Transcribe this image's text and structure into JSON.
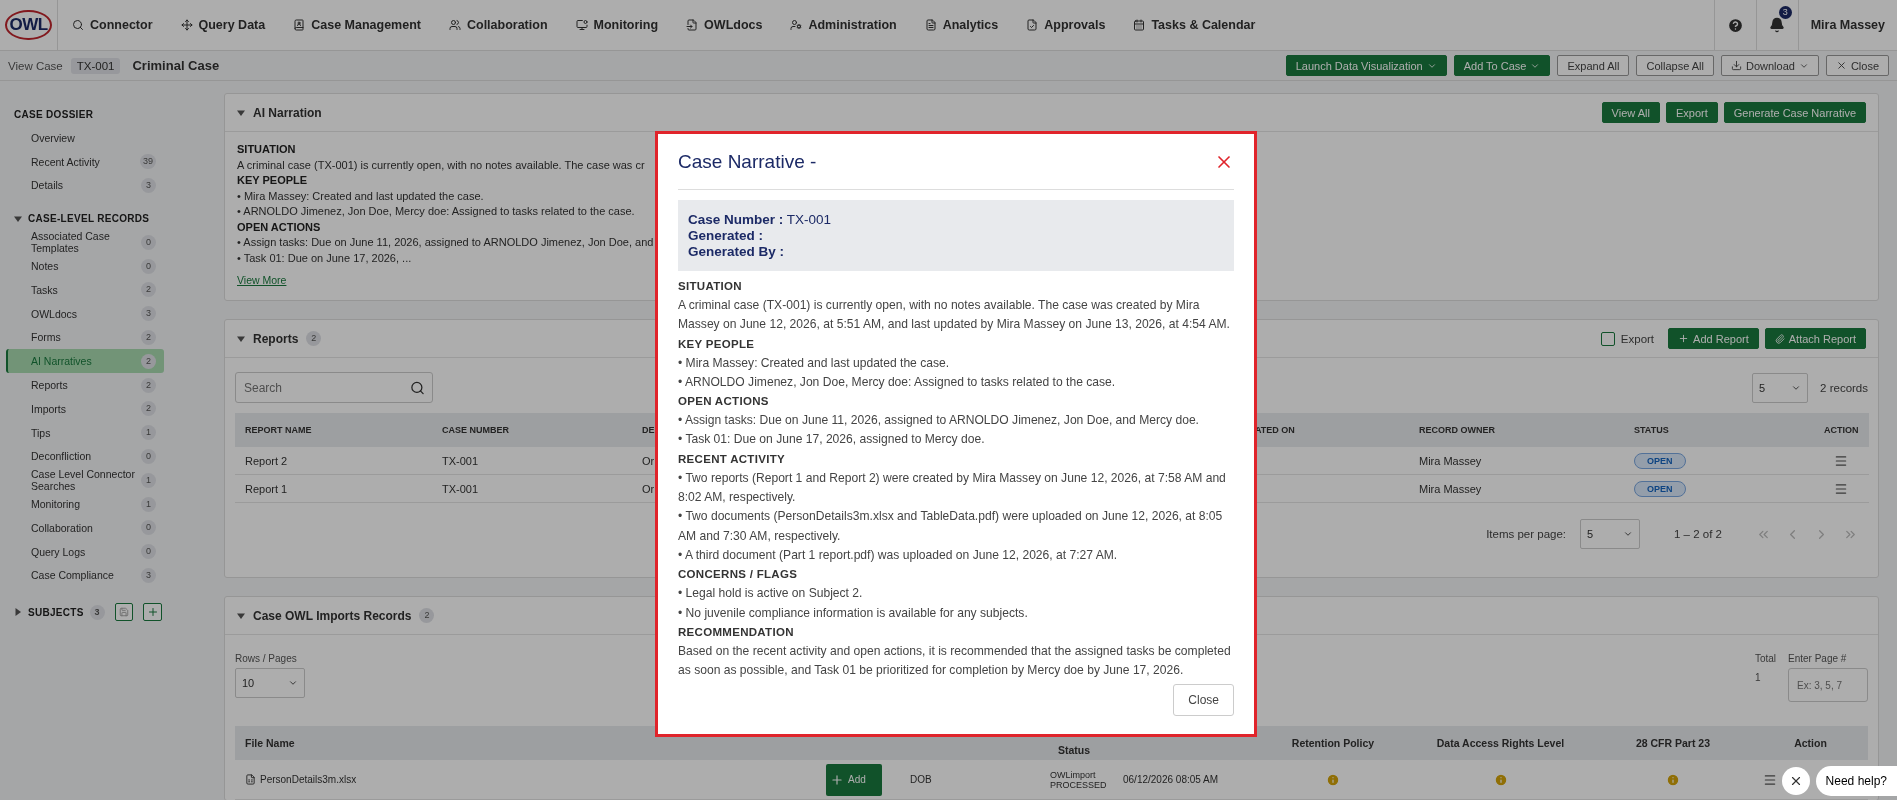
{
  "nav": {
    "logo_text": "OWL",
    "items": [
      "Connector",
      "Query Data",
      "Case Management",
      "Collaboration",
      "Monitoring",
      "OWLdocs",
      "Administration",
      "Analytics",
      "Approvals",
      "Tasks & Calendar"
    ],
    "notification_count": "3",
    "user": "Mira Massey"
  },
  "case_bar": {
    "label": "View Case",
    "case_id": "TX-001",
    "case_type": "Criminal Case",
    "actions": [
      {
        "label": "Launch Data Visualization",
        "kind": "dropdown"
      },
      {
        "label": "Add To Case",
        "kind": "dropdown"
      },
      {
        "label": "Expand All",
        "kind": "outline"
      },
      {
        "label": "Collapse All",
        "kind": "outline"
      },
      {
        "label": "Download",
        "kind": "download"
      },
      {
        "label": "Close",
        "kind": "close"
      }
    ]
  },
  "sidebar": {
    "sections": [
      {
        "title": "CASE DOSSIER",
        "kind": "plain",
        "items": [
          {
            "label": "Overview",
            "selected": false
          },
          {
            "label": "Recent Activity",
            "count": "39",
            "selected": false
          },
          {
            "label": "Details",
            "count": "3",
            "selected": false
          }
        ]
      },
      {
        "title": "CASE-LEVEL RECORDS",
        "kind": "collapsible",
        "expanded": true,
        "items": [
          {
            "label": "Associated Case Templates",
            "count": "0",
            "selected": false
          },
          {
            "label": "Notes",
            "count": "0",
            "selected": false
          },
          {
            "label": "Tasks",
            "count": "2",
            "selected": false
          },
          {
            "label": "OWLdocs",
            "count": "3",
            "selected": false
          },
          {
            "label": "Forms",
            "count": "2",
            "selected": false
          },
          {
            "label": "AI Narratives",
            "count": "2",
            "selected": true
          },
          {
            "label": "Reports",
            "count": "2",
            "selected": false
          },
          {
            "label": "Imports",
            "count": "2",
            "selected": false
          },
          {
            "label": "Tips",
            "count": "1",
            "selected": false
          },
          {
            "label": "Deconfliction",
            "count": "0",
            "selected": false
          },
          {
            "label": "Case Level Connector Searches",
            "count": "1",
            "selected": false
          },
          {
            "label": "Monitoring",
            "count": "1",
            "selected": false
          },
          {
            "label": "Collaboration",
            "count": "0",
            "selected": false
          },
          {
            "label": "Query Logs",
            "count": "0",
            "selected": false
          },
          {
            "label": "Case Compliance",
            "count": "3",
            "selected": false
          }
        ]
      },
      {
        "title": "SUBJECTS",
        "kind": "collapsible",
        "expanded": false,
        "count": "3"
      }
    ]
  },
  "ai_narration": {
    "title": "AI Narration",
    "expanded": true,
    "buttons": [
      "View All",
      "Export",
      "Generate Case Narrative"
    ],
    "lines": [
      {
        "kind": "heading",
        "text": "SITUATION"
      },
      {
        "kind": "text",
        "text": "A criminal case (TX-001) is currently open, with no notes available. The case was cr"
      },
      {
        "kind": "heading",
        "text": "KEY PEOPLE"
      },
      {
        "kind": "text",
        "text": "• Mira Massey: Created and last updated the case."
      },
      {
        "kind": "text",
        "text": "• ARNOLDO Jimenez, Jon Doe, Mercy doe: Assigned to tasks related to the case."
      },
      {
        "kind": "heading",
        "text": "OPEN ACTIONS"
      },
      {
        "kind": "text",
        "text": "• Assign tasks: Due on June 11, 2026, assigned to ARNOLDO Jimenez, Jon Doe, and"
      },
      {
        "kind": "text",
        "text": "• Task 01: Due on June 17, 2026, ..."
      }
    ],
    "link": "View More"
  },
  "reports": {
    "title": "Reports",
    "count": "2",
    "expanded": true,
    "export": {
      "label": "Export",
      "checked": false
    },
    "buttons": [
      "Add Report",
      "Attach Report"
    ],
    "search": {
      "placeholder": "Search"
    },
    "page_size": "5",
    "records": "2 records",
    "columns": [
      "REPORT NAME",
      "CASE NUMBER",
      "DE",
      "ATED ON",
      "RECORD OWNER",
      "STATUS",
      "ACTION"
    ],
    "rows": [
      {
        "cells": [
          "Report 2",
          "TX-001",
          "Or",
          "",
          "Mira Massey"
        ],
        "status": "OPEN"
      },
      {
        "cells": [
          "Report 1",
          "TX-001",
          "Or",
          "",
          "Mira Massey"
        ],
        "status": "OPEN"
      }
    ],
    "pagination": {
      "label": "Items per page:",
      "size": "5",
      "range": "1 – 2 of 2"
    }
  },
  "imports": {
    "title": "Case OWL Imports Records",
    "count": "2",
    "expanded": true,
    "rows_label": "Rows / Pages",
    "rows_value": "10",
    "total_label": "Total",
    "total_value": "1",
    "page_label": "Enter Page #",
    "page_placeholder": "Ex: 3, 5, 7",
    "columns": [
      "File Name",
      "Status",
      "Retention Policy",
      "Data Access Rights Level",
      "28 CFR Part 23",
      "Action"
    ],
    "rows": [
      {
        "file": "PersonDetails3m.xlsx",
        "add_label": "Add",
        "reference": "DOB",
        "status": "OWLimport PROCESSED",
        "uploaded": "06/12/2026 08:05 AM"
      }
    ]
  },
  "modal": {
    "title": "Case Narrative -",
    "info": [
      {
        "label": "Case Number :",
        "value": "TX-001"
      },
      {
        "label": "Generated :"
      },
      {
        "label": "Generated By :"
      }
    ],
    "sections": [
      {
        "heading": "SITUATION",
        "lines": [
          "A criminal case (TX-001) is currently open, with no notes available. The case was created by Mira Massey on June 12, 2026, at 5:51 AM, and last updated by Mira Massey on June 13, 2026, at 4:54 AM."
        ]
      },
      {
        "heading": "KEY PEOPLE",
        "lines": [
          "• Mira Massey: Created and last updated the case.",
          "• ARNOLDO Jimenez, Jon Doe, Mercy doe: Assigned to tasks related to the case."
        ]
      },
      {
        "heading": "OPEN ACTIONS",
        "lines": [
          "• Assign tasks: Due on June 11, 2026, assigned to ARNOLDO Jimenez, Jon Doe, and Mercy doe.",
          "• Task 01: Due on June 17, 2026, assigned to Mercy doe."
        ]
      },
      {
        "heading": "RECENT ACTIVITY",
        "lines": [
          "• Two reports (Report 1 and Report 2) were created by Mira Massey on June 12, 2026, at 7:58 AM and 8:02 AM, respectively.",
          "• Two documents (PersonDetails3m.xlsx and TableData.pdf) were uploaded on June 12, 2026, at 8:05 AM and 7:30 AM, respectively.",
          "• A third document (Part 1 report.pdf) was uploaded on June 12, 2026, at 7:27 AM."
        ]
      },
      {
        "heading": "CONCERNS / FLAGS",
        "lines": [
          "• Legal hold is active on Subject 2.",
          "• No juvenile compliance information is available for any subjects."
        ]
      },
      {
        "heading": "RECOMMENDATION",
        "lines": [
          "Based on the recent activity and open actions, it is recommended that the assigned tasks be completed as soon as possible, and Task 01 be prioritized for completion by Mercy doe by June 17, 2026."
        ]
      }
    ],
    "close_button": "Close"
  },
  "help_widget": {
    "label": "Need help?"
  }
}
